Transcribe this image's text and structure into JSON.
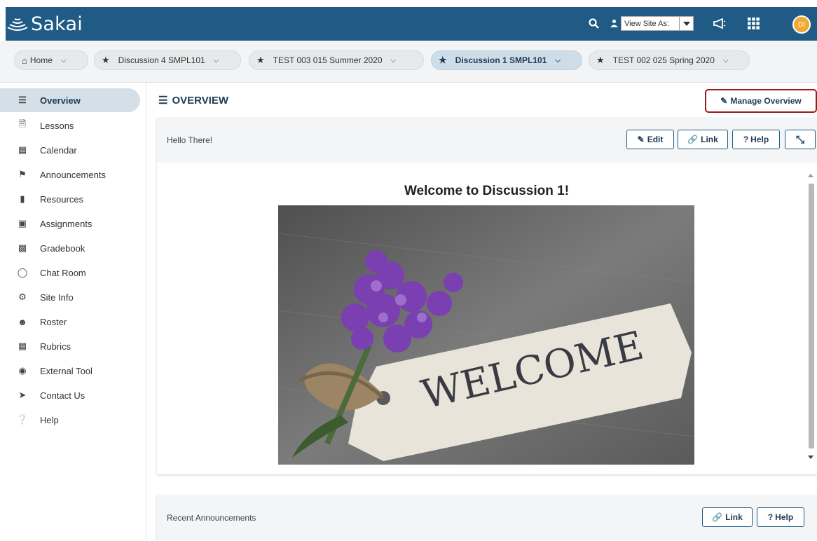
{
  "header": {
    "logo_text": "Sakai",
    "view_site_as": "View Site As:",
    "avatar_initials": "DI"
  },
  "site_tabs": [
    {
      "label": "Home",
      "active": false,
      "icon": "home-icon"
    },
    {
      "label": "Discussion 4 SMPL101",
      "active": false,
      "icon": "star-icon"
    },
    {
      "label": "TEST 003 015 Summer 2020",
      "active": false,
      "icon": "star-icon"
    },
    {
      "label": "Discussion 1 SMPL101",
      "active": true,
      "icon": "star-icon"
    },
    {
      "label": "TEST 002 025 Spring 2020",
      "active": false,
      "icon": "star-icon"
    }
  ],
  "sidebar": {
    "items": [
      {
        "label": "Overview",
        "icon": "list-icon",
        "active": true
      },
      {
        "label": "Lessons",
        "icon": "document-icon"
      },
      {
        "label": "Calendar",
        "icon": "calendar-icon"
      },
      {
        "label": "Announcements",
        "icon": "megaphone-icon"
      },
      {
        "label": "Resources",
        "icon": "folder-icon"
      },
      {
        "label": "Assignments",
        "icon": "file-icon"
      },
      {
        "label": "Gradebook",
        "icon": "book-icon"
      },
      {
        "label": "Chat Room",
        "icon": "chat-icon"
      },
      {
        "label": "Site Info",
        "icon": "gear-icon"
      },
      {
        "label": "Roster",
        "icon": "users-icon"
      },
      {
        "label": "Rubrics",
        "icon": "table-icon"
      },
      {
        "label": "External Tool",
        "icon": "globe-icon"
      },
      {
        "label": "Contact Us",
        "icon": "paper-plane-icon"
      },
      {
        "label": "Help",
        "icon": "question-icon"
      }
    ]
  },
  "main": {
    "title": "OVERVIEW",
    "manage_overview_label": "Manage Overview",
    "panel1": {
      "title": "Hello There!",
      "edit_label": "Edit",
      "link_label": "Link",
      "help_label": "Help",
      "welcome_heading": "Welcome to Discussion 1!",
      "tag_text": "WELCOME"
    },
    "panel2": {
      "title": "Recent Announcements",
      "link_label": "Link",
      "help_label": "Help"
    }
  },
  "colors": {
    "header_bg": "#1f5b84",
    "highlight_border": "#9b1b1b",
    "flower_purple": "#7a3fb0"
  }
}
